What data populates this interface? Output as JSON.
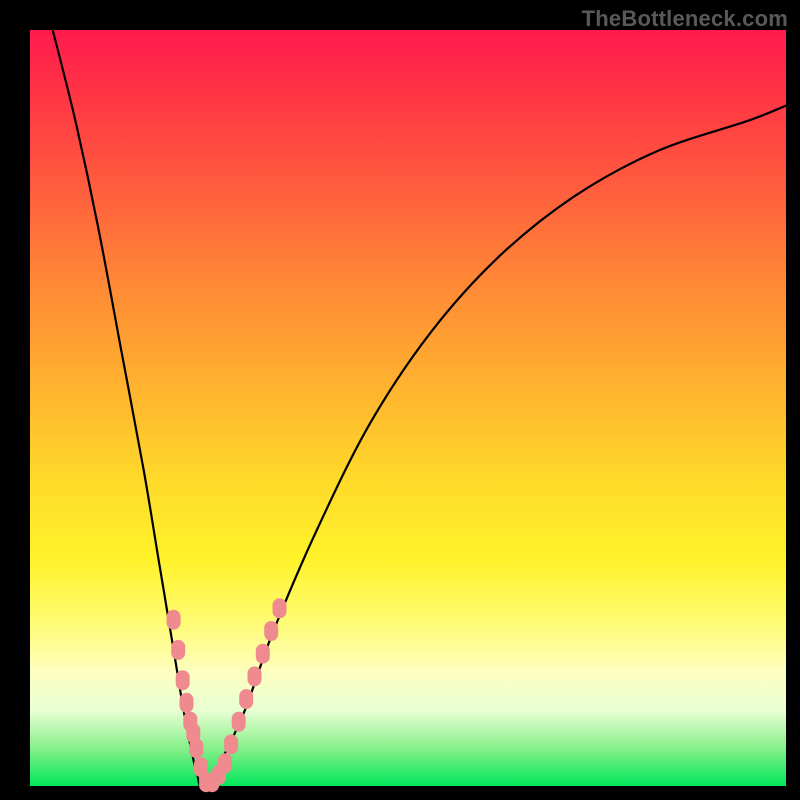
{
  "watermark": "TheBottleneck.com",
  "colors": {
    "marker": "#ef8a8f",
    "curve": "#000000",
    "frame": "#000000"
  },
  "chart_data": {
    "type": "line",
    "title": "",
    "xlabel": "",
    "ylabel": "",
    "xlim": [
      0,
      100
    ],
    "ylim": [
      0,
      100
    ],
    "grid": false,
    "legend": false,
    "series": [
      {
        "name": "bottleneck-curve",
        "x": [
          3,
          6,
          9,
          12,
          15,
          17,
          19,
          20.5,
          22,
          23.3,
          28,
          32,
          38,
          45,
          53,
          62,
          72,
          83,
          95,
          100
        ],
        "y": [
          100,
          88,
          74,
          58,
          42,
          30,
          18,
          9,
          2,
          0,
          9,
          20,
          34,
          48,
          60,
          70,
          78,
          84,
          88,
          90
        ]
      }
    ],
    "markers": [
      {
        "name": "left-cluster",
        "x": 19.0,
        "y": 22
      },
      {
        "name": "left-cluster",
        "x": 19.6,
        "y": 18
      },
      {
        "name": "left-cluster",
        "x": 20.2,
        "y": 14
      },
      {
        "name": "left-cluster",
        "x": 20.7,
        "y": 11
      },
      {
        "name": "left-cluster",
        "x": 21.2,
        "y": 8.5
      },
      {
        "name": "left-cluster",
        "x": 21.6,
        "y": 7
      },
      {
        "name": "left-cluster",
        "x": 22.0,
        "y": 5
      },
      {
        "name": "bottom",
        "x": 22.6,
        "y": 2.5
      },
      {
        "name": "bottom",
        "x": 23.3,
        "y": 0.5
      },
      {
        "name": "bottom",
        "x": 24.1,
        "y": 0.5
      },
      {
        "name": "bottom",
        "x": 25.0,
        "y": 1.5
      },
      {
        "name": "bottom",
        "x": 25.8,
        "y": 3
      },
      {
        "name": "right-cluster",
        "x": 26.6,
        "y": 5.5
      },
      {
        "name": "right-cluster",
        "x": 27.6,
        "y": 8.5
      },
      {
        "name": "right-cluster",
        "x": 28.6,
        "y": 11.5
      },
      {
        "name": "right-cluster",
        "x": 29.7,
        "y": 14.5
      },
      {
        "name": "right-cluster",
        "x": 30.8,
        "y": 17.5
      },
      {
        "name": "right-cluster",
        "x": 31.9,
        "y": 20.5
      },
      {
        "name": "right-cluster",
        "x": 33.0,
        "y": 23.5
      }
    ]
  }
}
